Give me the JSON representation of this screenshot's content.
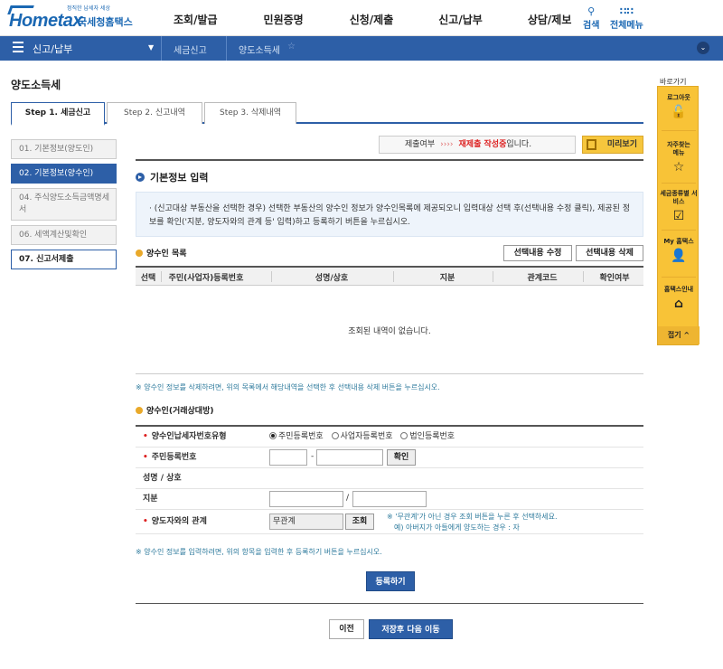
{
  "header": {
    "logo_slogan": "정직한 납세자 세상",
    "logo_word": "Hometax",
    "logo_sub": "국세청홈택스",
    "menu": [
      "조회/발급",
      "민원증명",
      "신청/제출",
      "신고/납부",
      "상담/제보"
    ],
    "search_label": "검색",
    "allmenu_label": "전체메뉴"
  },
  "navbar": {
    "main": "신고/납부",
    "crumb1": "세금신고",
    "crumb2": "양도소득세"
  },
  "page_title": "양도소득세",
  "tabs": [
    "Step 1. 세금신고",
    "Step 2. 신고내역",
    "Step 3. 삭제내역"
  ],
  "steps": [
    "01. 기본정보(양도인)",
    "02. 기본정보(양수인)",
    "04. 주식양도소득금액명세서",
    "06. 세액계산및확인",
    "07. 신고서제출"
  ],
  "status": {
    "label": "제출여부",
    "arrows": "››››",
    "red": "재제출 작성중",
    "suffix": "입니다.",
    "preview": "미리보기"
  },
  "section_title": "기본정보 입력",
  "info_text": "· (신고대상 부동산을 선택한 경우) 선택한 부동산의 양수인 정보가 양수인목록에 제공되오니 입력대상 선택 후(선택내용 수정 클릭), 제공된 정보를 확인('지분, 양도자와의 관계 등' 입력)하고 등록하기 버튼을 누르십시오.",
  "list": {
    "title": "양수인 목록",
    "btn_edit": "선택내용 수정",
    "btn_delete": "선택내용 삭제",
    "columns": [
      "선택",
      "주민(사업자)등록번호",
      "성명/상호",
      "지분",
      "관계코드",
      "확인여부"
    ],
    "empty": "조회된 내역이 없습니다.",
    "note": "※ 양수인 정보를 삭제하려면, 위의 목록에서 해당내역을 선택한 후 선택내용 삭제 버튼을 누르십시오."
  },
  "form": {
    "title": "양수인(거래상대방)",
    "type_label": "양수인납세자번호유형",
    "type_options": [
      "주민등록번호",
      "사업자등록번호",
      "법인등록번호"
    ],
    "rrn_label": "주민등록번호",
    "rrn_sep": "-",
    "confirm_btn": "확인",
    "name_label": "성명 / 상호",
    "share_label": "지분",
    "share_sep": "/",
    "relation_label": "양도자와의 관계",
    "relation_value": "무관계",
    "lookup_btn": "조회",
    "relation_note1": "※ '무관계'가 아닌 경우 조회 버튼을 누른 후 선택하세요.",
    "relation_note2": "예) 아버지가 아들에게 양도하는 경우 : 자",
    "note": "※ 양수인 정보를 입력하려면, 위의 항목을 입력한 후 등록하기 버튼을 누르십시오.",
    "register_btn": "등록하기"
  },
  "footer": {
    "prev_btn": "이전",
    "next_btn": "저장후 다음 이동"
  },
  "quick": {
    "title": "바로가기",
    "items": [
      "로그아웃",
      "자주찾는 메뉴",
      "세금종류별 서비스",
      "My 홈택스",
      "홈택스인내"
    ],
    "fold": "접기 ^"
  }
}
